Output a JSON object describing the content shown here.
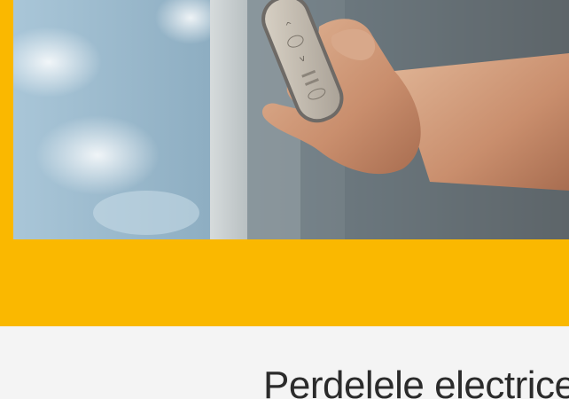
{
  "hero": {
    "image_subject": "hand-holding-remote-control-photo",
    "band_color": "#fab800"
  },
  "section": {
    "heading": "Perdelele electrice"
  }
}
